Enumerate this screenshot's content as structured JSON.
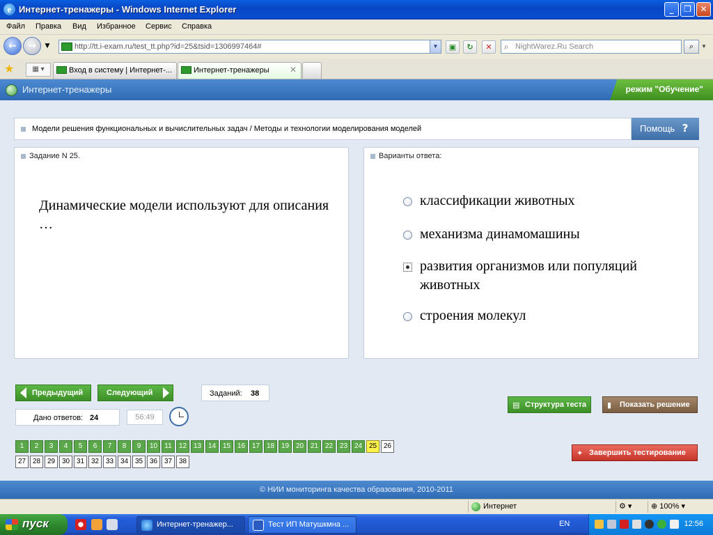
{
  "window": {
    "title": "Интернет-тренажеры - Windows Internet Explorer",
    "minimize": "_",
    "maximize": "❐",
    "close": "✕"
  },
  "menu": [
    "Файл",
    "Правка",
    "Вид",
    "Избранное",
    "Сервис",
    "Справка"
  ],
  "address": {
    "url": "http://tt.i-exam.ru/test_tt.php?id=25&tsid=1306997464#",
    "search_placeholder": "NightWarez.Ru Search"
  },
  "tabs": [
    {
      "label": "Вход в систему | Интернет-..."
    },
    {
      "label": "Интернет-тренажеры"
    }
  ],
  "app": {
    "name": "Интернет-тренажеры",
    "mode": "режим \"Обучение\""
  },
  "breadcrumb": "Модели решения функциональных и вычислительных задач / Методы и технологии моделирования моделей",
  "help": {
    "label": "Помощь",
    "icon": "?"
  },
  "task": {
    "title": "Задание N 25.",
    "question": "Динамические модели используют для описания …"
  },
  "answers": {
    "title": "Варианты ответа:",
    "options": [
      {
        "text": "классификации  животных",
        "checked": false
      },
      {
        "text": "механизма динамомашины",
        "checked": false
      },
      {
        "text": "развития организмов или популяций животных",
        "checked": true
      },
      {
        "text": "строения молекул",
        "checked": false
      }
    ]
  },
  "nav": {
    "prev": "Предыдущий",
    "next": "Следующий",
    "tasks_label": "Заданий:",
    "tasks_count": "38",
    "answered_label": "Дано ответов:",
    "answered_count": "24",
    "timer": "56:49",
    "structure": "Структура теста",
    "show_solution": "Показать решение",
    "finish": "Завершить тестирование"
  },
  "questions": {
    "total": 38,
    "answered_through": 24,
    "current": 25,
    "labels": [
      "1",
      "2",
      "3",
      "4",
      "5",
      "6",
      "7",
      "8",
      "9",
      "10",
      "11",
      "12",
      "13",
      "14",
      "15",
      "16",
      "17",
      "18",
      "19",
      "20",
      "21",
      "22",
      "23",
      "24",
      "25",
      "26",
      "27",
      "28",
      "29",
      "30",
      "31",
      "32",
      "33",
      "34",
      "35",
      "36",
      "37",
      "38"
    ]
  },
  "footer": "© НИИ мониторинга качества образования, 2010-2011",
  "status": {
    "zone": "Интернет",
    "zoom": "100%"
  },
  "taskbar": {
    "start": "пуск",
    "items": [
      "Интернет-тренажер...",
      "Тест ИП Матушкмна ..."
    ],
    "lang": "EN",
    "clock": "12:56"
  },
  "colors": {
    "accent_blue": "#2f6bb5",
    "done_green": "#5aa84a",
    "current_yellow": "#fff24a",
    "finish_red": "#d9443a",
    "solution_brown": "#8a6a4a"
  }
}
